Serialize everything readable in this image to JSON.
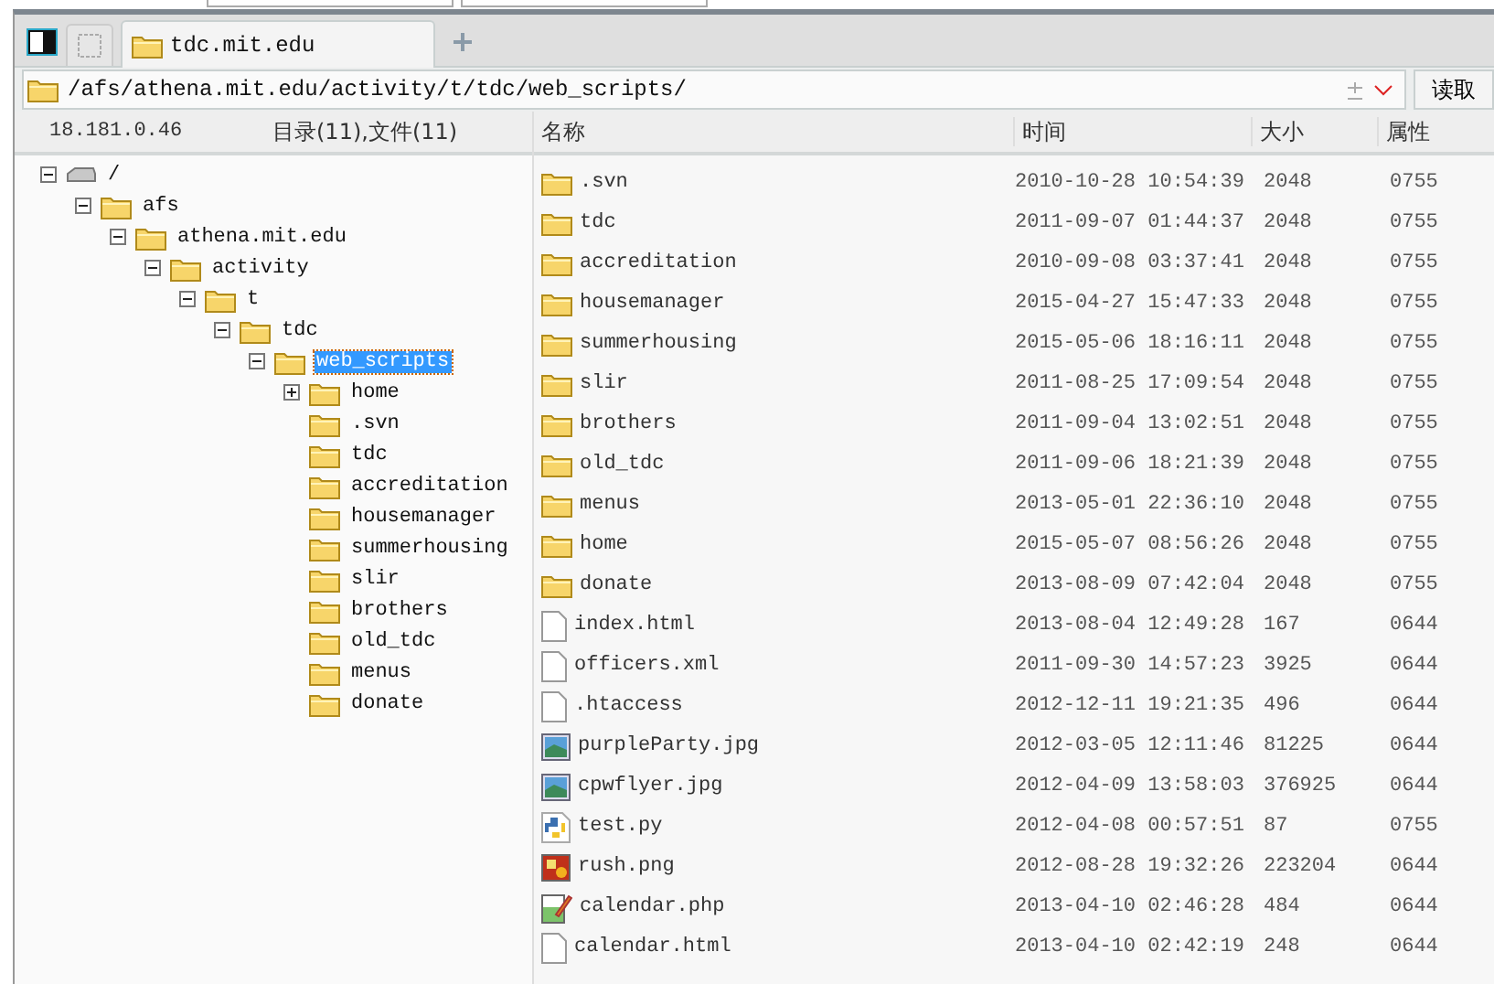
{
  "tabs": [
    {
      "label": "tdc.mit.edu",
      "selected": true
    }
  ],
  "address": {
    "value": "/afs/athena.mit.edu/activity/t/tdc/web_scripts/",
    "button": "读取"
  },
  "status": {
    "server": "18.181.0.46",
    "summary": "目录(11),文件(11)"
  },
  "columns": [
    "名称",
    "时间",
    "大小",
    "属性"
  ],
  "tree": [
    {
      "label": "/",
      "kind": "drive",
      "expanded": true,
      "selected": false,
      "children": [
        {
          "label": "afs",
          "kind": "folder",
          "expanded": true,
          "selected": false,
          "children": [
            {
              "label": "athena.mit.edu",
              "kind": "folder",
              "expanded": true,
              "selected": false,
              "children": [
                {
                  "label": "activity",
                  "kind": "folder",
                  "expanded": true,
                  "selected": false,
                  "children": [
                    {
                      "label": "t",
                      "kind": "folder",
                      "expanded": true,
                      "selected": false,
                      "children": [
                        {
                          "label": "tdc",
                          "kind": "folder",
                          "expanded": true,
                          "selected": false,
                          "children": [
                            {
                              "label": "web_scripts",
                              "kind": "folder",
                              "expanded": true,
                              "selected": true,
                              "children": [
                                {
                                  "label": "home",
                                  "kind": "folder",
                                  "expanded": false,
                                  "selected": false
                                },
                                {
                                  "label": ".svn",
                                  "kind": "folder",
                                  "selected": false
                                },
                                {
                                  "label": "tdc",
                                  "kind": "folder",
                                  "selected": false
                                },
                                {
                                  "label": "accreditation",
                                  "kind": "folder",
                                  "selected": false
                                },
                                {
                                  "label": "housemanager",
                                  "kind": "folder",
                                  "selected": false
                                },
                                {
                                  "label": "summerhousing",
                                  "kind": "folder",
                                  "selected": false
                                },
                                {
                                  "label": "slir",
                                  "kind": "folder",
                                  "selected": false
                                },
                                {
                                  "label": "brothers",
                                  "kind": "folder",
                                  "selected": false
                                },
                                {
                                  "label": "old_tdc",
                                  "kind": "folder",
                                  "selected": false
                                },
                                {
                                  "label": "menus",
                                  "kind": "folder",
                                  "selected": false
                                },
                                {
                                  "label": "donate",
                                  "kind": "folder",
                                  "selected": false
                                }
                              ]
                            }
                          ]
                        }
                      ]
                    }
                  ]
                }
              ]
            }
          ]
        }
      ]
    }
  ],
  "files": [
    {
      "name": ".svn",
      "kind": "folder",
      "time": "2010-10-28 10:54:39",
      "size": "2048",
      "mode": "0755"
    },
    {
      "name": "tdc",
      "kind": "folder",
      "time": "2011-09-07 01:44:37",
      "size": "2048",
      "mode": "0755"
    },
    {
      "name": "accreditation",
      "kind": "folder",
      "time": "2010-09-08 03:37:41",
      "size": "2048",
      "mode": "0755"
    },
    {
      "name": "housemanager",
      "kind": "folder",
      "time": "2015-04-27 15:47:33",
      "size": "2048",
      "mode": "0755"
    },
    {
      "name": "summerhousing",
      "kind": "folder",
      "time": "2015-05-06 18:16:11",
      "size": "2048",
      "mode": "0755"
    },
    {
      "name": "slir",
      "kind": "folder",
      "time": "2011-08-25 17:09:54",
      "size": "2048",
      "mode": "0755"
    },
    {
      "name": "brothers",
      "kind": "folder",
      "time": "2011-09-04 13:02:51",
      "size": "2048",
      "mode": "0755"
    },
    {
      "name": "old_tdc",
      "kind": "folder",
      "time": "2011-09-06 18:21:39",
      "size": "2048",
      "mode": "0755"
    },
    {
      "name": "menus",
      "kind": "folder",
      "time": "2013-05-01 22:36:10",
      "size": "2048",
      "mode": "0755"
    },
    {
      "name": "home",
      "kind": "folder",
      "time": "2015-05-07 08:56:26",
      "size": "2048",
      "mode": "0755"
    },
    {
      "name": "donate",
      "kind": "folder",
      "time": "2013-08-09 07:42:04",
      "size": "2048",
      "mode": "0755"
    },
    {
      "name": "index.html",
      "kind": "file",
      "time": "2013-08-04 12:49:28",
      "size": "167",
      "mode": "0644"
    },
    {
      "name": "officers.xml",
      "kind": "file",
      "time": "2011-09-30 14:57:23",
      "size": "3925",
      "mode": "0644"
    },
    {
      "name": ".htaccess",
      "kind": "file",
      "time": "2012-12-11 19:21:35",
      "size": "496",
      "mode": "0644"
    },
    {
      "name": "purpleParty.jpg",
      "kind": "image",
      "time": "2012-03-05 12:11:46",
      "size": "81225",
      "mode": "0644"
    },
    {
      "name": "cpwflyer.jpg",
      "kind": "image",
      "time": "2012-04-09 13:58:03",
      "size": "376925",
      "mode": "0644"
    },
    {
      "name": "test.py",
      "kind": "python",
      "time": "2012-04-08 00:57:51",
      "size": "87",
      "mode": "0755"
    },
    {
      "name": "rush.png",
      "kind": "picture",
      "time": "2012-08-28 19:32:26",
      "size": "223204",
      "mode": "0644"
    },
    {
      "name": "calendar.php",
      "kind": "script",
      "time": "2013-04-10 02:46:28",
      "size": "484",
      "mode": "0644"
    },
    {
      "name": "calendar.html",
      "kind": "file",
      "time": "2013-04-10 02:42:19",
      "size": "248",
      "mode": "0644"
    }
  ]
}
